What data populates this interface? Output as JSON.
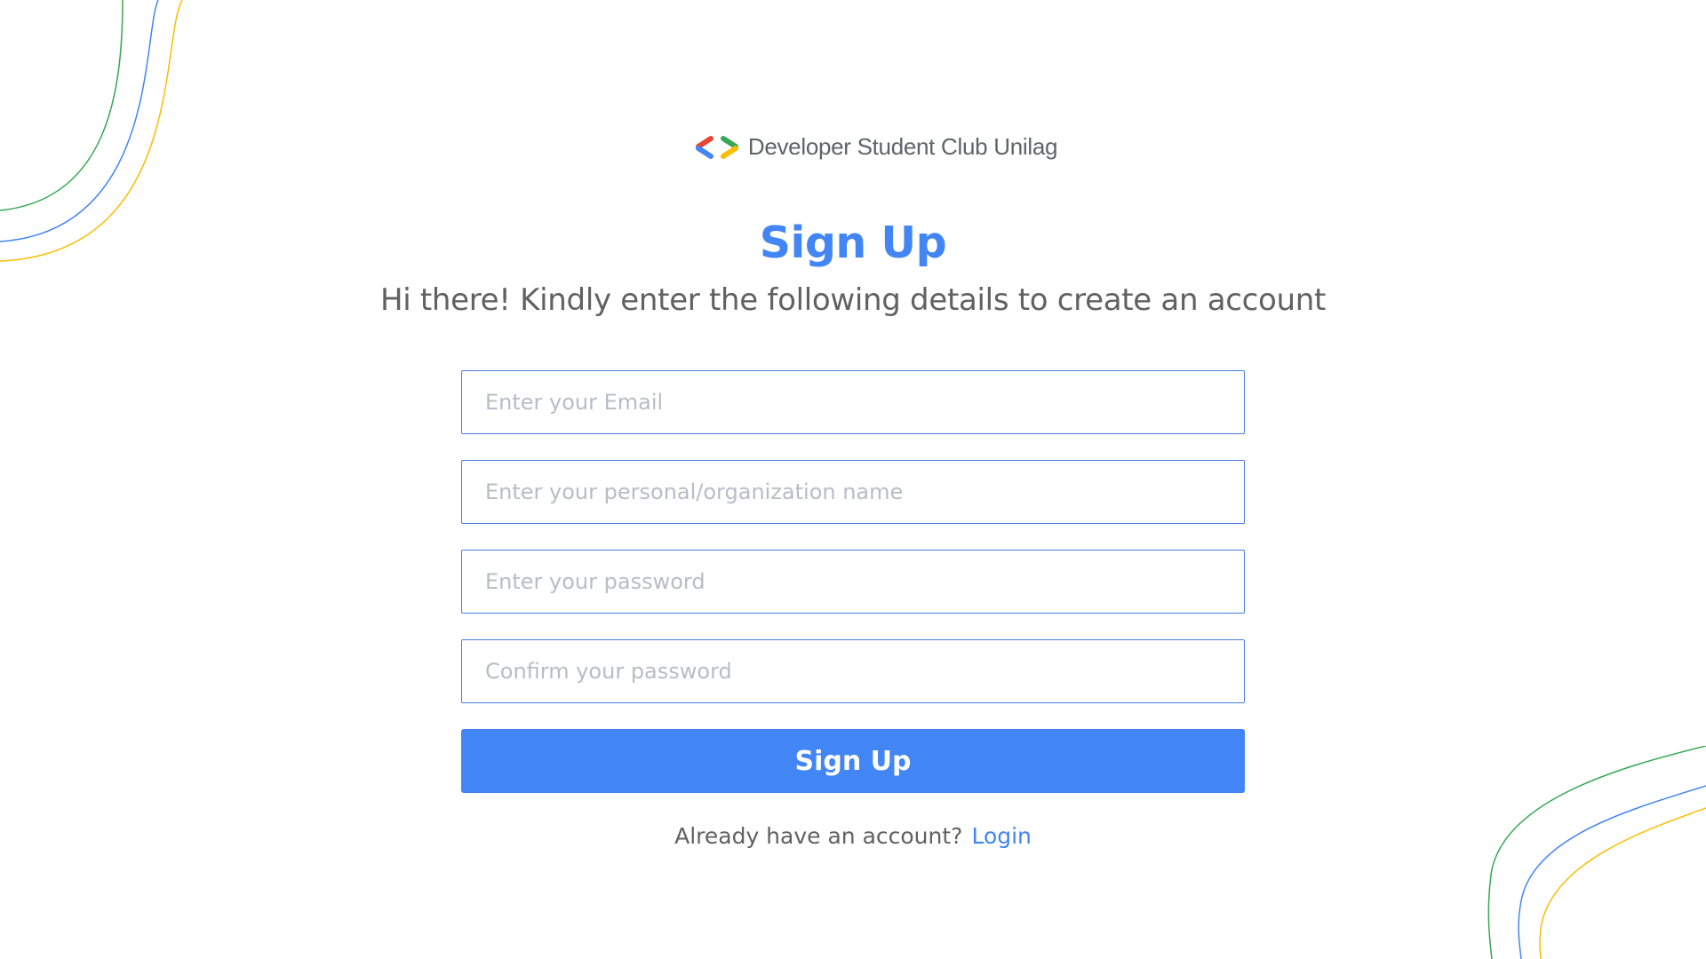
{
  "brand": {
    "name": "Developer Student Club Unilag",
    "logo_icon": "gdsc-brackets-icon",
    "colors": {
      "red": "#ea4335",
      "blue": "#4285f4",
      "green": "#34a853",
      "yellow": "#fbbc04"
    }
  },
  "header": {
    "title": "Sign Up",
    "subtitle": "Hi there! Kindly enter the following details to create an account"
  },
  "form": {
    "email_placeholder": "Enter your Email",
    "name_placeholder": "Enter your personal/organization name",
    "password_placeholder": "Enter your password",
    "confirm_placeholder": "Confirm your password",
    "submit_label": "Sign Up"
  },
  "footer": {
    "prompt": "Already have an account?",
    "login_label": "Login"
  },
  "colors": {
    "accent": "#4285f4",
    "deco_green": "#34a853",
    "deco_blue": "#4285f4",
    "deco_yellow": "#fbbc04"
  }
}
